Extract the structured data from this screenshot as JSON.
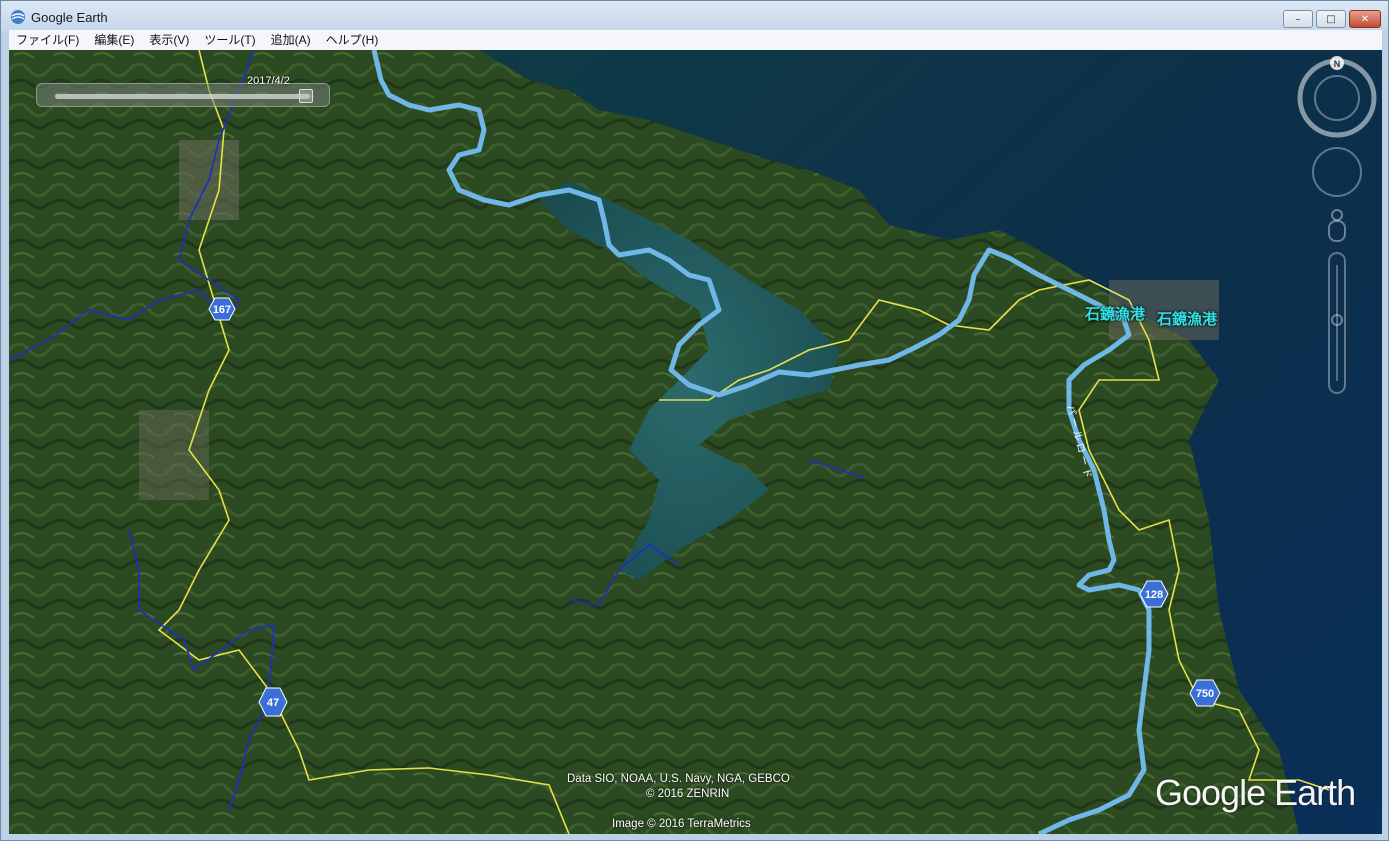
{
  "window": {
    "title": "Google Earth"
  },
  "titlebar_buttons": {
    "minimize": "–",
    "maximize": "□",
    "close": "✕"
  },
  "menu": [
    {
      "label": "ファイル(F)"
    },
    {
      "label": "編集(E)"
    },
    {
      "label": "表示(V)"
    },
    {
      "label": "ツール(T)"
    },
    {
      "label": "追加(A)"
    },
    {
      "label": "ヘルプ(H)"
    }
  ],
  "time_slider": {
    "date": "2017/4/2"
  },
  "places": {
    "label_1": "石鏡漁港",
    "label_2": "石鏡漁港"
  },
  "road_shields": {
    "r167": "167",
    "r47": "47",
    "r128": "128",
    "r750": "750"
  },
  "road_name": "パールロード",
  "navigation": {
    "north_label": "N"
  },
  "credits": {
    "data": "Data SIO, NOAA, U.S. Navy, NGA, GEBCO",
    "zenrin": "© 2016 ZENRIN",
    "image": "Image © 2016 TerraMetrics"
  },
  "brand": "Google Earth",
  "colors": {
    "route": "#6fb7e6",
    "boundary": "#e6e04a",
    "border": "#1b2fc4",
    "label": "#33e0e6",
    "shield": "#3a6fd8"
  }
}
